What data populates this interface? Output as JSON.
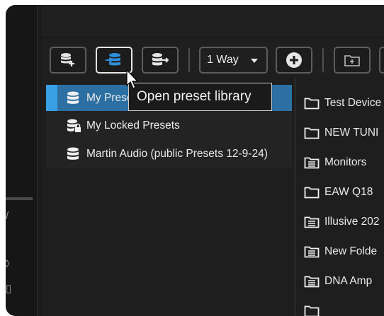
{
  "toolbar": {
    "buttons": [
      {
        "name": "add-preset",
        "icon": "database-add-icon"
      },
      {
        "name": "open-library",
        "icon": "database-open-icon",
        "active": true
      },
      {
        "name": "export-preset",
        "icon": "database-export-icon"
      }
    ],
    "way_select": {
      "value": "1 Way"
    },
    "add_icon": "plus-circle-icon",
    "folder_icon": "folder-add-icon"
  },
  "tooltip": {
    "text": "Open preset library"
  },
  "library_tree": [
    {
      "label": "My Presets",
      "icon": "database-icon",
      "selected": true
    },
    {
      "label": "My Locked Presets",
      "icon": "database-lock-icon"
    },
    {
      "label": "Martin Audio (public Presets 12-9-24)",
      "icon": "database-icon"
    }
  ],
  "folders": [
    {
      "label": "Test Device",
      "icon": "folder-icon"
    },
    {
      "label": "NEW TUNI",
      "icon": "folder-icon"
    },
    {
      "label": "Monitors",
      "icon": "folder-list-icon"
    },
    {
      "label": "EAW Q18",
      "icon": "folder-icon"
    },
    {
      "label": "Illusive 202",
      "icon": "folder-list-icon"
    },
    {
      "label": "New Folde",
      "icon": "folder-list-icon"
    },
    {
      "label": "DNA Amp",
      "icon": "folder-list-icon"
    }
  ],
  "colors": {
    "accent": "#3aa0e6",
    "selected_row": "#2c6fa3",
    "background": "#1e1e1e"
  }
}
